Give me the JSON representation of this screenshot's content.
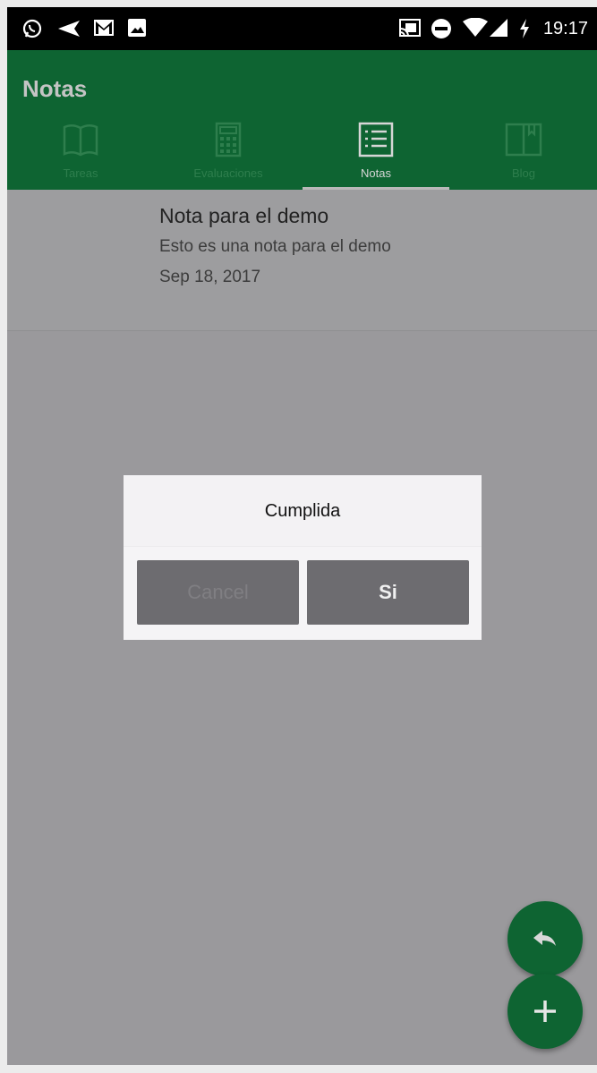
{
  "status_bar": {
    "time": "19:17",
    "icons": [
      "whatsapp-icon",
      "send-icon",
      "gmail-icon",
      "image-icon",
      "cast-icon",
      "do-not-disturb-icon",
      "wifi-icon",
      "cell-signal-icon",
      "battery-charging-icon"
    ]
  },
  "app_bar": {
    "title": "Notas",
    "colors": {
      "primary": "#0e6432",
      "tab_inactive": "#2e7e4d"
    }
  },
  "tabs": [
    {
      "label": "Tareas",
      "icon": "book-icon",
      "active": false
    },
    {
      "label": "Evaluaciones",
      "icon": "calculator-icon",
      "active": false
    },
    {
      "label": "Notas",
      "icon": "list-icon",
      "active": true
    },
    {
      "label": "Blog",
      "icon": "bookmark-book-icon",
      "active": false
    }
  ],
  "notes": [
    {
      "title": "Nota para el demo",
      "body": "Esto es una nota para el demo",
      "date": "Sep 18, 2017"
    }
  ],
  "dialog": {
    "title": "Cumplida",
    "cancel_label": "Cancel",
    "confirm_label": "Si"
  },
  "fabs": [
    {
      "icon": "reply-icon"
    },
    {
      "icon": "plus-icon"
    }
  ]
}
